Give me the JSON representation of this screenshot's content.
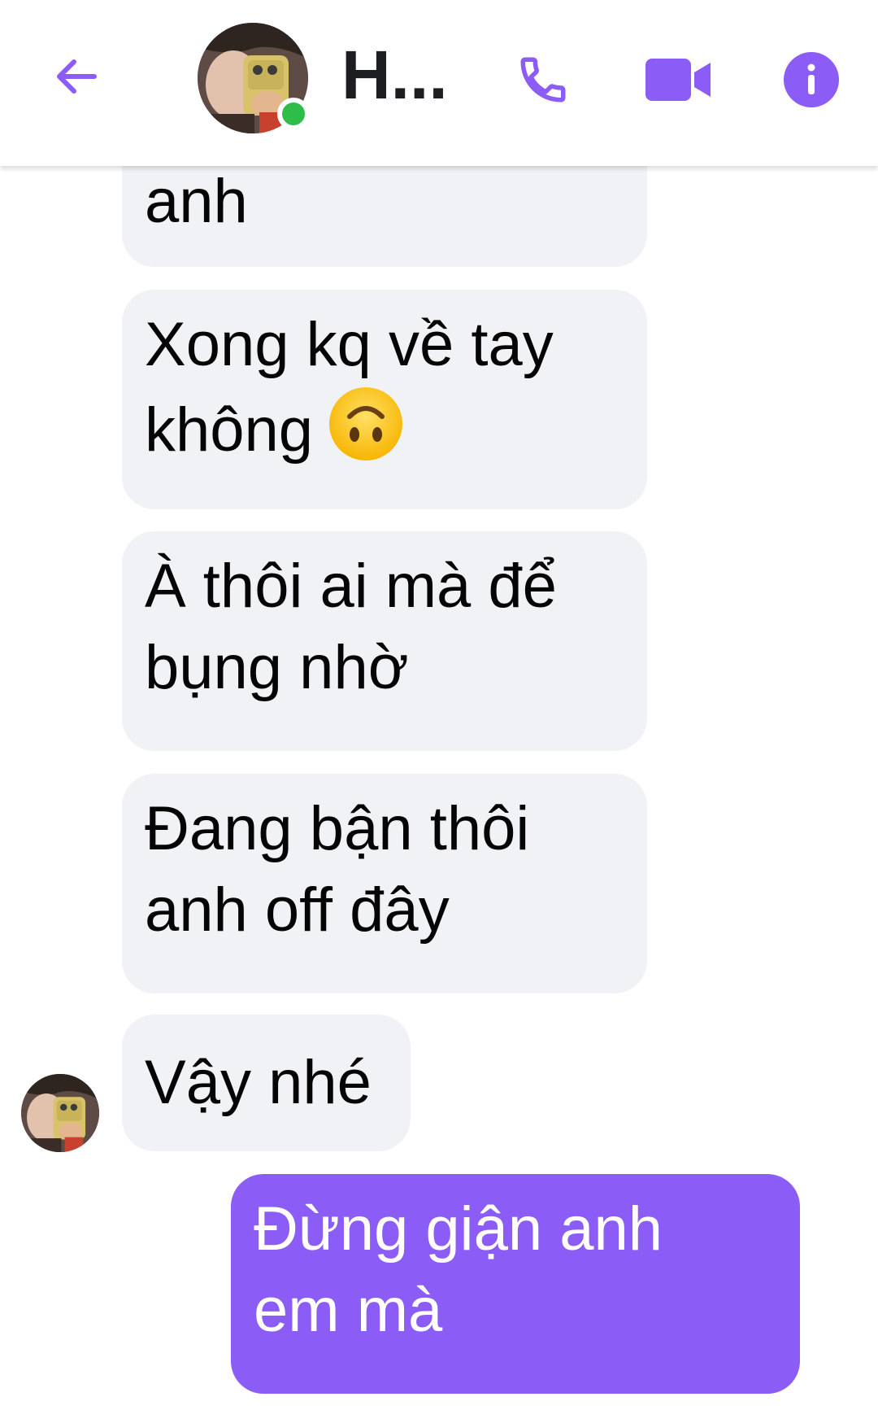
{
  "header": {
    "contact_name": "H...",
    "online_status_color": "#2fbd4a",
    "accent_color": "#8b5cf6",
    "icons": [
      "back-arrow-icon",
      "phone-icon",
      "video-camera-icon",
      "info-icon"
    ]
  },
  "messages": [
    {
      "direction": "incoming",
      "lines": [
        "anh"
      ]
    },
    {
      "direction": "incoming",
      "lines": [
        "Xong kq về tay",
        "không"
      ],
      "emoji": "upside-down-face-emoji"
    },
    {
      "direction": "incoming",
      "lines": [
        "À thôi ai mà để",
        "bụng nhờ"
      ]
    },
    {
      "direction": "incoming",
      "lines": [
        "Đang bận thôi",
        "anh off đây"
      ]
    },
    {
      "direction": "incoming",
      "lines": [
        "Vậy nhé"
      ]
    },
    {
      "direction": "outgoing",
      "lines": [
        "Đừng giận anh",
        "em mà"
      ]
    }
  ]
}
